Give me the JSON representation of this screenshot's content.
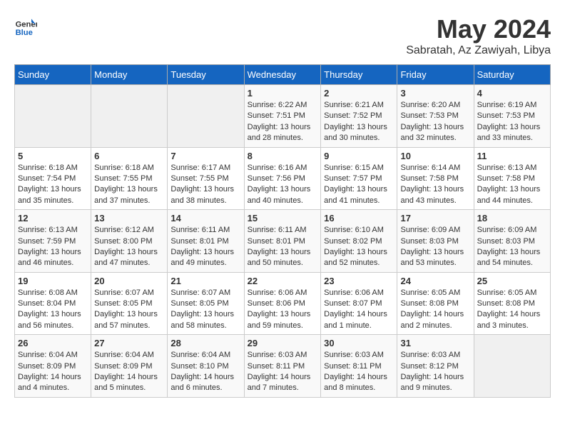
{
  "header": {
    "logo_line1": "General",
    "logo_line2": "Blue",
    "month": "May 2024",
    "location": "Sabratah, Az Zawiyah, Libya"
  },
  "weekdays": [
    "Sunday",
    "Monday",
    "Tuesday",
    "Wednesday",
    "Thursday",
    "Friday",
    "Saturday"
  ],
  "weeks": [
    [
      {
        "day": "",
        "info": ""
      },
      {
        "day": "",
        "info": ""
      },
      {
        "day": "",
        "info": ""
      },
      {
        "day": "1",
        "info": "Sunrise: 6:22 AM\nSunset: 7:51 PM\nDaylight: 13 hours\nand 28 minutes."
      },
      {
        "day": "2",
        "info": "Sunrise: 6:21 AM\nSunset: 7:52 PM\nDaylight: 13 hours\nand 30 minutes."
      },
      {
        "day": "3",
        "info": "Sunrise: 6:20 AM\nSunset: 7:53 PM\nDaylight: 13 hours\nand 32 minutes."
      },
      {
        "day": "4",
        "info": "Sunrise: 6:19 AM\nSunset: 7:53 PM\nDaylight: 13 hours\nand 33 minutes."
      }
    ],
    [
      {
        "day": "5",
        "info": "Sunrise: 6:18 AM\nSunset: 7:54 PM\nDaylight: 13 hours\nand 35 minutes."
      },
      {
        "day": "6",
        "info": "Sunrise: 6:18 AM\nSunset: 7:55 PM\nDaylight: 13 hours\nand 37 minutes."
      },
      {
        "day": "7",
        "info": "Sunrise: 6:17 AM\nSunset: 7:55 PM\nDaylight: 13 hours\nand 38 minutes."
      },
      {
        "day": "8",
        "info": "Sunrise: 6:16 AM\nSunset: 7:56 PM\nDaylight: 13 hours\nand 40 minutes."
      },
      {
        "day": "9",
        "info": "Sunrise: 6:15 AM\nSunset: 7:57 PM\nDaylight: 13 hours\nand 41 minutes."
      },
      {
        "day": "10",
        "info": "Sunrise: 6:14 AM\nSunset: 7:58 PM\nDaylight: 13 hours\nand 43 minutes."
      },
      {
        "day": "11",
        "info": "Sunrise: 6:13 AM\nSunset: 7:58 PM\nDaylight: 13 hours\nand 44 minutes."
      }
    ],
    [
      {
        "day": "12",
        "info": "Sunrise: 6:13 AM\nSunset: 7:59 PM\nDaylight: 13 hours\nand 46 minutes."
      },
      {
        "day": "13",
        "info": "Sunrise: 6:12 AM\nSunset: 8:00 PM\nDaylight: 13 hours\nand 47 minutes."
      },
      {
        "day": "14",
        "info": "Sunrise: 6:11 AM\nSunset: 8:01 PM\nDaylight: 13 hours\nand 49 minutes."
      },
      {
        "day": "15",
        "info": "Sunrise: 6:11 AM\nSunset: 8:01 PM\nDaylight: 13 hours\nand 50 minutes."
      },
      {
        "day": "16",
        "info": "Sunrise: 6:10 AM\nSunset: 8:02 PM\nDaylight: 13 hours\nand 52 minutes."
      },
      {
        "day": "17",
        "info": "Sunrise: 6:09 AM\nSunset: 8:03 PM\nDaylight: 13 hours\nand 53 minutes."
      },
      {
        "day": "18",
        "info": "Sunrise: 6:09 AM\nSunset: 8:03 PM\nDaylight: 13 hours\nand 54 minutes."
      }
    ],
    [
      {
        "day": "19",
        "info": "Sunrise: 6:08 AM\nSunset: 8:04 PM\nDaylight: 13 hours\nand 56 minutes."
      },
      {
        "day": "20",
        "info": "Sunrise: 6:07 AM\nSunset: 8:05 PM\nDaylight: 13 hours\nand 57 minutes."
      },
      {
        "day": "21",
        "info": "Sunrise: 6:07 AM\nSunset: 8:05 PM\nDaylight: 13 hours\nand 58 minutes."
      },
      {
        "day": "22",
        "info": "Sunrise: 6:06 AM\nSunset: 8:06 PM\nDaylight: 13 hours\nand 59 minutes."
      },
      {
        "day": "23",
        "info": "Sunrise: 6:06 AM\nSunset: 8:07 PM\nDaylight: 14 hours\nand 1 minute."
      },
      {
        "day": "24",
        "info": "Sunrise: 6:05 AM\nSunset: 8:08 PM\nDaylight: 14 hours\nand 2 minutes."
      },
      {
        "day": "25",
        "info": "Sunrise: 6:05 AM\nSunset: 8:08 PM\nDaylight: 14 hours\nand 3 minutes."
      }
    ],
    [
      {
        "day": "26",
        "info": "Sunrise: 6:04 AM\nSunset: 8:09 PM\nDaylight: 14 hours\nand 4 minutes."
      },
      {
        "day": "27",
        "info": "Sunrise: 6:04 AM\nSunset: 8:09 PM\nDaylight: 14 hours\nand 5 minutes."
      },
      {
        "day": "28",
        "info": "Sunrise: 6:04 AM\nSunset: 8:10 PM\nDaylight: 14 hours\nand 6 minutes."
      },
      {
        "day": "29",
        "info": "Sunrise: 6:03 AM\nSunset: 8:11 PM\nDaylight: 14 hours\nand 7 minutes."
      },
      {
        "day": "30",
        "info": "Sunrise: 6:03 AM\nSunset: 8:11 PM\nDaylight: 14 hours\nand 8 minutes."
      },
      {
        "day": "31",
        "info": "Sunrise: 6:03 AM\nSunset: 8:12 PM\nDaylight: 14 hours\nand 9 minutes."
      },
      {
        "day": "",
        "info": ""
      }
    ]
  ]
}
